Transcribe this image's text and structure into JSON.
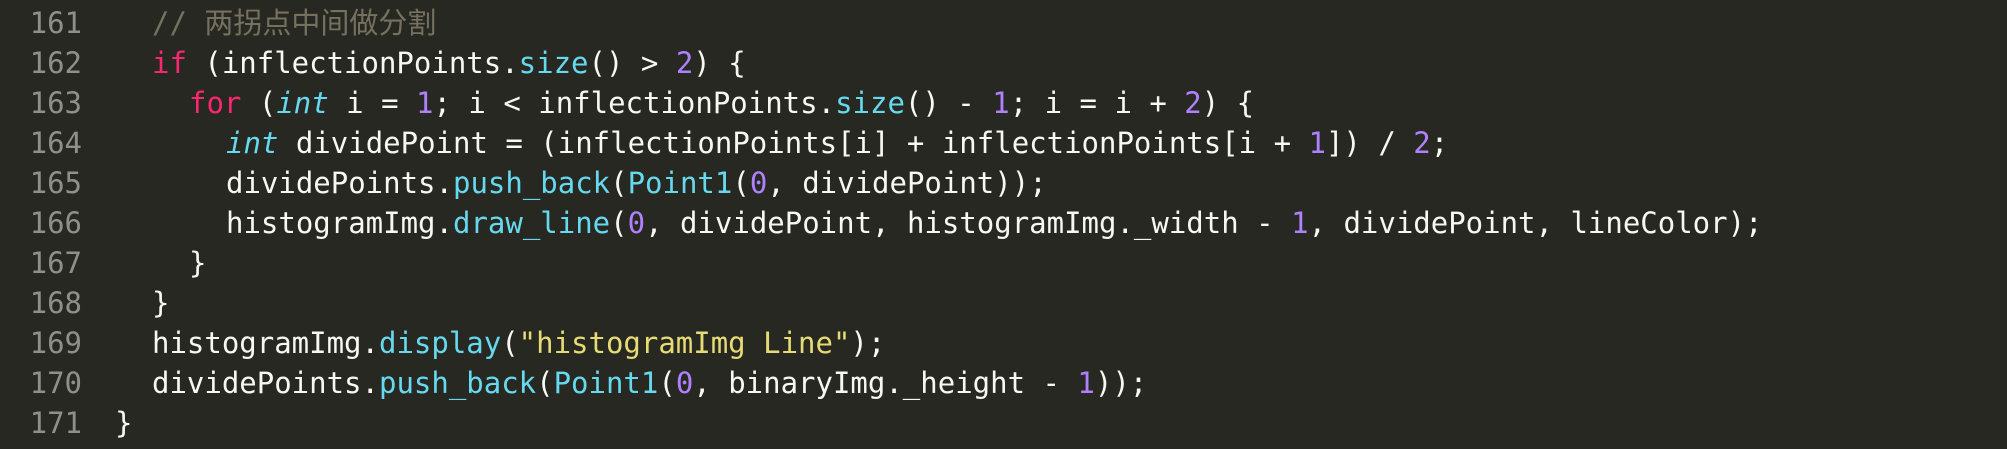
{
  "colors": {
    "background": "#272822",
    "gutter": "#8f908a",
    "plain": "#f8f8f2",
    "comment": "#75715e",
    "keyword": "#f92672",
    "type": "#66d9ef",
    "func": "#66d9ef",
    "number": "#ae81ff",
    "string": "#e6db74"
  },
  "lines": [
    {
      "number": "161",
      "indent": 1,
      "tokens": [
        {
          "t": "comment",
          "v": "// 两拐点中间做分割"
        }
      ]
    },
    {
      "number": "162",
      "indent": 1,
      "tokens": [
        {
          "t": "keyword",
          "v": "if"
        },
        {
          "t": "plain",
          "v": " (inflectionPoints."
        },
        {
          "t": "func",
          "v": "size"
        },
        {
          "t": "plain",
          "v": "() > "
        },
        {
          "t": "number",
          "v": "2"
        },
        {
          "t": "plain",
          "v": ") {"
        }
      ]
    },
    {
      "number": "163",
      "indent": 2,
      "tokens": [
        {
          "t": "keyword",
          "v": "for"
        },
        {
          "t": "plain",
          "v": " ("
        },
        {
          "t": "type",
          "v": "int"
        },
        {
          "t": "plain",
          "v": " i = "
        },
        {
          "t": "number",
          "v": "1"
        },
        {
          "t": "plain",
          "v": "; i < inflectionPoints."
        },
        {
          "t": "func",
          "v": "size"
        },
        {
          "t": "plain",
          "v": "() - "
        },
        {
          "t": "number",
          "v": "1"
        },
        {
          "t": "plain",
          "v": "; i = i + "
        },
        {
          "t": "number",
          "v": "2"
        },
        {
          "t": "plain",
          "v": ") {"
        }
      ]
    },
    {
      "number": "164",
      "indent": 3,
      "tokens": [
        {
          "t": "type",
          "v": "int"
        },
        {
          "t": "plain",
          "v": " dividePoint = (inflectionPoints[i] + inflectionPoints[i + "
        },
        {
          "t": "number",
          "v": "1"
        },
        {
          "t": "plain",
          "v": "]) / "
        },
        {
          "t": "number",
          "v": "2"
        },
        {
          "t": "plain",
          "v": ";"
        }
      ]
    },
    {
      "number": "165",
      "indent": 3,
      "tokens": [
        {
          "t": "plain",
          "v": "dividePoints."
        },
        {
          "t": "func",
          "v": "push_back"
        },
        {
          "t": "plain",
          "v": "("
        },
        {
          "t": "func",
          "v": "Point1"
        },
        {
          "t": "plain",
          "v": "("
        },
        {
          "t": "number",
          "v": "0"
        },
        {
          "t": "plain",
          "v": ", dividePoint));"
        }
      ]
    },
    {
      "number": "166",
      "indent": 3,
      "tokens": [
        {
          "t": "plain",
          "v": "histogramImg."
        },
        {
          "t": "func",
          "v": "draw_line"
        },
        {
          "t": "plain",
          "v": "("
        },
        {
          "t": "number",
          "v": "0"
        },
        {
          "t": "plain",
          "v": ", dividePoint, histogramImg._width - "
        },
        {
          "t": "number",
          "v": "1"
        },
        {
          "t": "plain",
          "v": ", dividePoint, lineColor);"
        }
      ]
    },
    {
      "number": "167",
      "indent": 2,
      "tokens": [
        {
          "t": "plain",
          "v": "}"
        }
      ]
    },
    {
      "number": "168",
      "indent": 1,
      "tokens": [
        {
          "t": "plain",
          "v": "}"
        }
      ]
    },
    {
      "number": "169",
      "indent": 1,
      "tokens": [
        {
          "t": "plain",
          "v": "histogramImg."
        },
        {
          "t": "func",
          "v": "display"
        },
        {
          "t": "plain",
          "v": "("
        },
        {
          "t": "string",
          "v": "\"histogramImg Line\""
        },
        {
          "t": "plain",
          "v": ");"
        }
      ]
    },
    {
      "number": "170",
      "indent": 1,
      "tokens": [
        {
          "t": "plain",
          "v": "dividePoints."
        },
        {
          "t": "func",
          "v": "push_back"
        },
        {
          "t": "plain",
          "v": "("
        },
        {
          "t": "func",
          "v": "Point1"
        },
        {
          "t": "plain",
          "v": "("
        },
        {
          "t": "number",
          "v": "0"
        },
        {
          "t": "plain",
          "v": ", binaryImg._height - "
        },
        {
          "t": "number",
          "v": "1"
        },
        {
          "t": "plain",
          "v": "));"
        }
      ]
    },
    {
      "number": "171",
      "indent": 0,
      "tokens": [
        {
          "t": "plain",
          "v": "}"
        }
      ]
    }
  ]
}
